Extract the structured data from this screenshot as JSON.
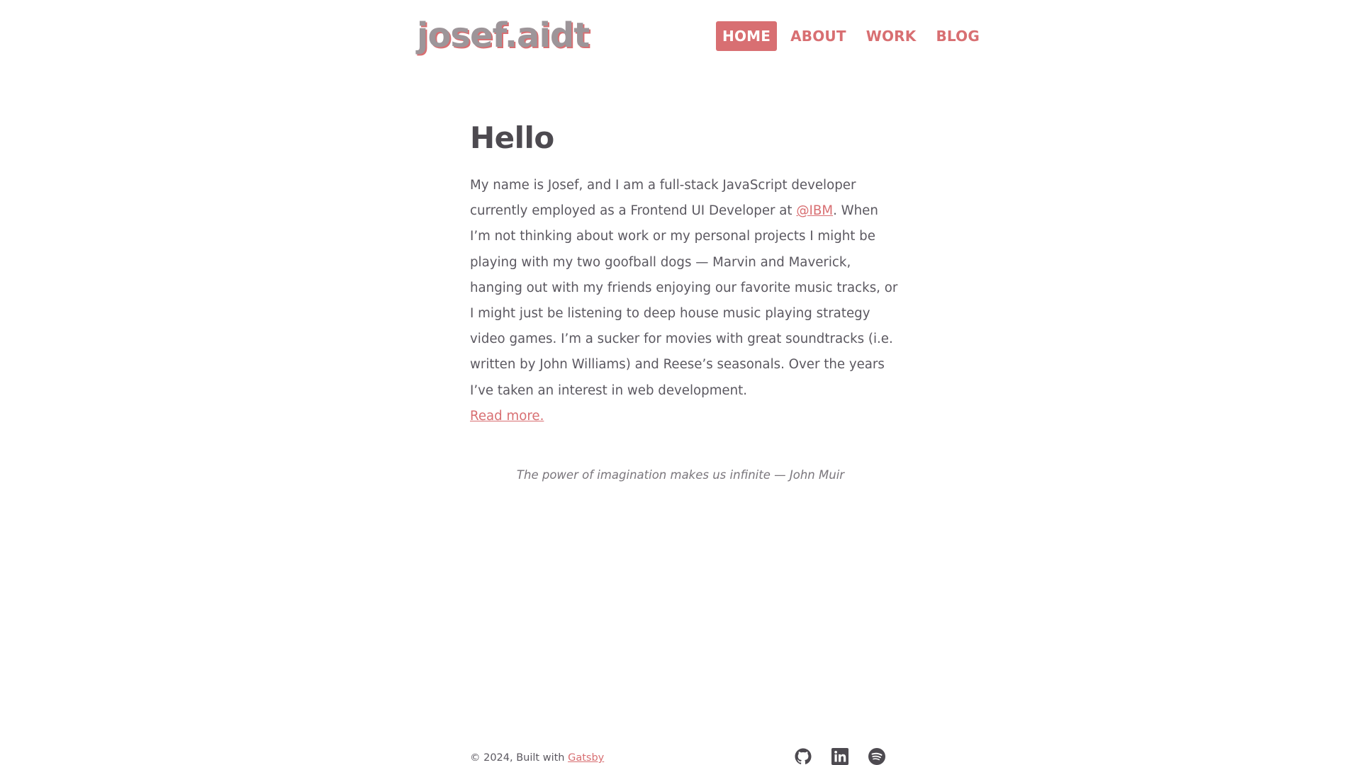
{
  "header": {
    "logo": "josef.aidt",
    "nav": [
      {
        "label": "HOME",
        "active": true
      },
      {
        "label": "ABOUT",
        "active": false
      },
      {
        "label": "WORK",
        "active": false
      },
      {
        "label": "BLOG",
        "active": false
      }
    ]
  },
  "main": {
    "title": "Hello",
    "intro_before_link": "My name is Josef, and I am a full-stack JavaScript developer currently employed as a Frontend UI Developer at ",
    "ibm_link": "@IBM",
    "intro_after_link": ". When I’m not thinking about work or my personal projects I might be playing with my two goofball dogs — Marvin and Maverick, hanging out with my friends enjoying our favorite music tracks, or I might just be listening to deep house music playing strategy video games. I’m a sucker for movies with great soundtracks (i.e. written by John Williams) and Reese’s seasonals. Over the years I’ve taken an interest in web development.",
    "read_more": "Read more.",
    "quote": "The power of imagination makes us infinite — John Muir"
  },
  "footer": {
    "copyright": "© 2024, Built with ",
    "gatsby_link": "Gatsby",
    "social_icons": [
      "github-icon",
      "linkedin-icon",
      "spotify-icon"
    ]
  },
  "colors": {
    "accent": "#d86f72",
    "text": "#4d4a50",
    "logo": "#9d9599",
    "background": "#ffffff"
  }
}
